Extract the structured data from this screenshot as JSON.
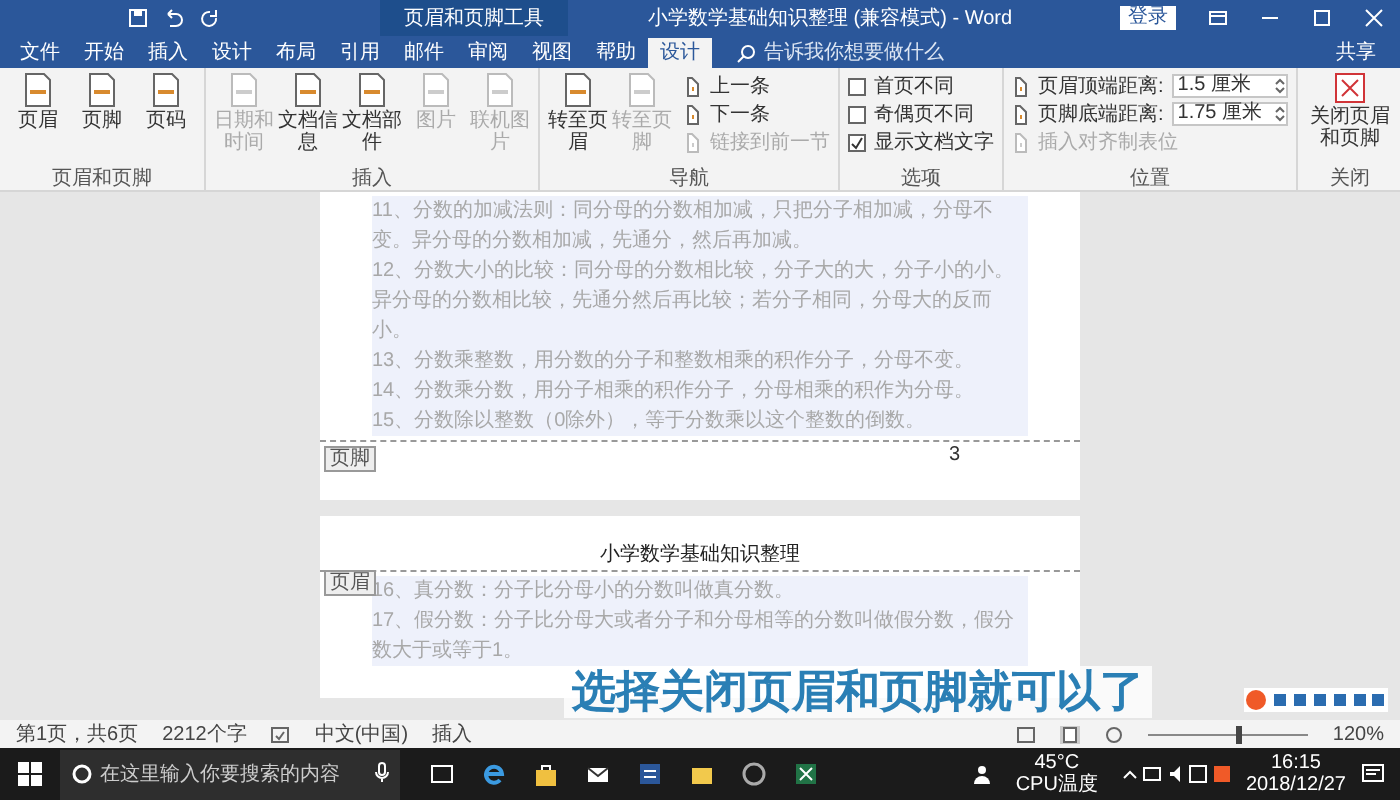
{
  "title_bar": {
    "context_label": "页眉和页脚工具",
    "title": "小学数学基础知识整理 (兼容模式) - Word",
    "login": "登录"
  },
  "tabs": [
    {
      "label": "文件",
      "selected": false
    },
    {
      "label": "开始",
      "selected": false
    },
    {
      "label": "插入",
      "selected": false
    },
    {
      "label": "设计",
      "selected": false
    },
    {
      "label": "布局",
      "selected": false
    },
    {
      "label": "引用",
      "selected": false
    },
    {
      "label": "邮件",
      "selected": false
    },
    {
      "label": "审阅",
      "selected": false
    },
    {
      "label": "视图",
      "selected": false
    },
    {
      "label": "帮助",
      "selected": false
    },
    {
      "label": "设计",
      "selected": true
    }
  ],
  "tell_me": {
    "placeholder": "告诉我你想要做什么"
  },
  "share": "共享",
  "ribbon": [
    {
      "label": "页眉和页脚",
      "items": [
        {
          "kind": "button",
          "label": "页眉",
          "disabled": false
        },
        {
          "kind": "button",
          "label": "页脚",
          "disabled": false
        },
        {
          "kind": "button",
          "label": "页码",
          "disabled": false
        }
      ]
    },
    {
      "label": "插入",
      "items": [
        {
          "kind": "button",
          "label": "日期和时间",
          "disabled": true
        },
        {
          "kind": "button",
          "label": "文档信息",
          "disabled": false
        },
        {
          "kind": "button",
          "label": "文档部件",
          "disabled": false
        },
        {
          "kind": "button",
          "label": "图片",
          "disabled": true
        },
        {
          "kind": "button",
          "label": "联机图片",
          "disabled": true
        }
      ]
    },
    {
      "label": "导航",
      "items": [
        {
          "kind": "button",
          "label": "转至页眉",
          "disabled": false
        },
        {
          "kind": "button",
          "label": "转至页脚",
          "disabled": true
        },
        {
          "kind": "stack",
          "rows": [
            {
              "label": "上一条",
              "disabled": false
            },
            {
              "label": "下一条",
              "disabled": false
            },
            {
              "label": "链接到前一节",
              "disabled": true
            }
          ]
        }
      ]
    },
    {
      "label": "选项",
      "items": [
        {
          "kind": "checks",
          "rows": [
            {
              "label": "首页不同",
              "checked": false
            },
            {
              "label": "奇偶页不同",
              "checked": false
            },
            {
              "label": "显示文档文字",
              "checked": true
            }
          ]
        }
      ]
    },
    {
      "label": "位置",
      "items": [
        {
          "kind": "spins",
          "rows": [
            {
              "label": "页眉顶端距离:",
              "value": "1.5 厘米"
            },
            {
              "label": "页脚底端距离:",
              "value": "1.75 厘米"
            }
          ],
          "extra": {
            "label": "插入对齐制表位",
            "disabled": true
          }
        }
      ]
    },
    {
      "label": "关闭",
      "items": [
        {
          "kind": "close",
          "label": "关闭页眉和页脚",
          "disabled": false
        }
      ]
    }
  ],
  "document": {
    "page_1": {
      "paragraphs": [
        "11、分数的加减法则：同分母的分数相加减，只把分子相加减，分母不变。异分母的分数相加减，先通分，然后再加减。",
        "12、分数大小的比较：同分母的分数相比较，分子大的大，分子小的小。异分母的分数相比较，先通分然后再比较；若分子相同，分母大的反而小。",
        "13、分数乘整数，用分数的分子和整数相乘的积作分子，分母不变。",
        "14、分数乘分数，用分子相乘的积作分子，分母相乘的积作为分母。",
        "15、分数除以整数（0除外），等于分数乘以这个整数的倒数。"
      ],
      "footer_tag": "页脚",
      "page_number": "3"
    },
    "page_2": {
      "header_text": "小学数学基础知识整理",
      "header_tag": "页眉",
      "paragraphs": [
        "16、真分数：分子比分母小的分数叫做真分数。",
        "17、假分数：分子比分母大或者分子和分母相等的分数叫做假分数，假分数大于或等于1。"
      ]
    }
  },
  "caption": "选择关闭页眉和页脚就可以了",
  "status_bar": {
    "page_info": "第1页，共6页",
    "word_count": "2212个字",
    "language": "中文(中国)",
    "mode": "插入",
    "zoom": "120%",
    "level": 0.55
  },
  "taskbar": {
    "search_placeholder": "在这里输入你要搜索的内容",
    "temperature": "45°C",
    "temperature_label": "CPU温度",
    "time": "16:15",
    "date": "2018/12/27"
  }
}
